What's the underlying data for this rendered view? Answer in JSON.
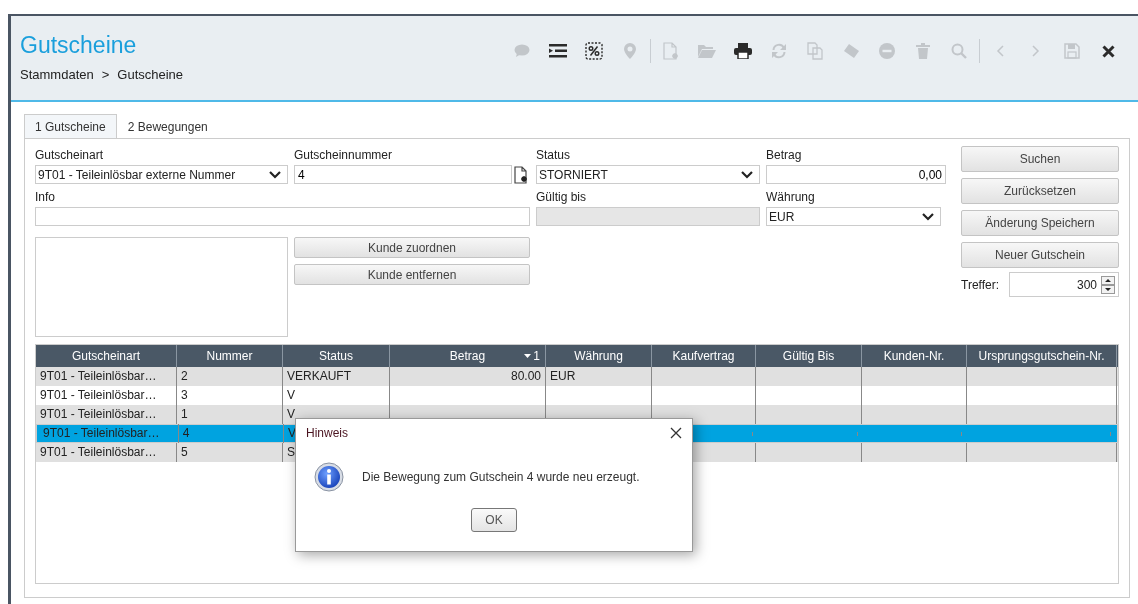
{
  "header": {
    "title": "Gutscheine",
    "breadcrumb": [
      "Stammdaten",
      "Gutscheine"
    ],
    "breadcrumb_separator": ">"
  },
  "toolbar": [
    {
      "kind": "comment",
      "disabled": true
    },
    {
      "kind": "list",
      "disabled": false
    },
    {
      "kind": "voucher",
      "disabled": false
    },
    {
      "kind": "pin",
      "disabled": true
    },
    {
      "kind": "separator"
    },
    {
      "kind": "new",
      "disabled": true
    },
    {
      "kind": "open",
      "disabled": true
    },
    {
      "kind": "print",
      "disabled": false
    },
    {
      "kind": "refresh",
      "disabled": true
    },
    {
      "kind": "copy",
      "disabled": true
    },
    {
      "kind": "eraser",
      "disabled": true
    },
    {
      "kind": "remove",
      "disabled": true
    },
    {
      "kind": "trash",
      "disabled": true
    },
    {
      "kind": "search",
      "disabled": true
    },
    {
      "kind": "separator"
    },
    {
      "kind": "prev",
      "disabled": true
    },
    {
      "kind": "next",
      "disabled": true
    },
    {
      "kind": "save",
      "disabled": true
    },
    {
      "kind": "close",
      "disabled": false
    }
  ],
  "tabs": [
    {
      "label": "1 Gutscheine",
      "selected": true
    },
    {
      "label": "2 Bewegungen",
      "selected": false
    }
  ],
  "form": {
    "gutscheinart": {
      "label": "Gutscheinart",
      "value": "9T01 - Teileinlösbar externe Nummer"
    },
    "gutscheinnummer": {
      "label": "Gutscheinnummer",
      "value": "4"
    },
    "status": {
      "label": "Status",
      "value": "STORNIERT"
    },
    "betrag": {
      "label": "Betrag",
      "value": "0,00"
    },
    "info": {
      "label": "Info"
    },
    "gueltig_bis": {
      "label": "Gültig bis",
      "disabled": true
    },
    "waehrung": {
      "label": "Währung",
      "value": "EUR"
    }
  },
  "customer_buttons": [
    "Kunde zuordnen",
    "Kunde entfernen"
  ],
  "action_buttons": [
    "Suchen",
    "Zurücksetzen",
    "Änderung Speichern",
    "Neuer Gutschein"
  ],
  "treffer": {
    "label": "Treffer:",
    "value": "300"
  },
  "table": {
    "columns": [
      {
        "label": "Gutscheinart"
      },
      {
        "label": "Nummer"
      },
      {
        "label": "Status"
      },
      {
        "label": "Betrag",
        "sort": "1"
      },
      {
        "label": "Währung"
      },
      {
        "label": "Kaufvertrag"
      },
      {
        "label": "Gültig Bis"
      },
      {
        "label": "Kunden-Nr."
      },
      {
        "label": "Ursprungsgutschein-Nr."
      }
    ],
    "rows": [
      {
        "cells": [
          "9T01 - Teileinlösbar…",
          "2",
          "VERKAUFT",
          "80.00",
          "EUR"
        ],
        "selected": false
      },
      {
        "cells": [
          "9T01 - Teileinlösbar…",
          "3",
          "V"
        ],
        "selected": false
      },
      {
        "cells": [
          "9T01 - Teileinlösbar…",
          "1",
          "V"
        ],
        "selected": false
      },
      {
        "cells": [
          "9T01 - Teileinlösbar…",
          "4",
          "V"
        ],
        "selected": true
      },
      {
        "cells": [
          "9T01 - Teileinlösbar…",
          "5",
          "S"
        ],
        "selected": false
      }
    ]
  },
  "dialog": {
    "title": "Hinweis",
    "message": "Die Bewegung zum Gutschein 4 wurde neu erzeugt.",
    "button": "OK"
  }
}
